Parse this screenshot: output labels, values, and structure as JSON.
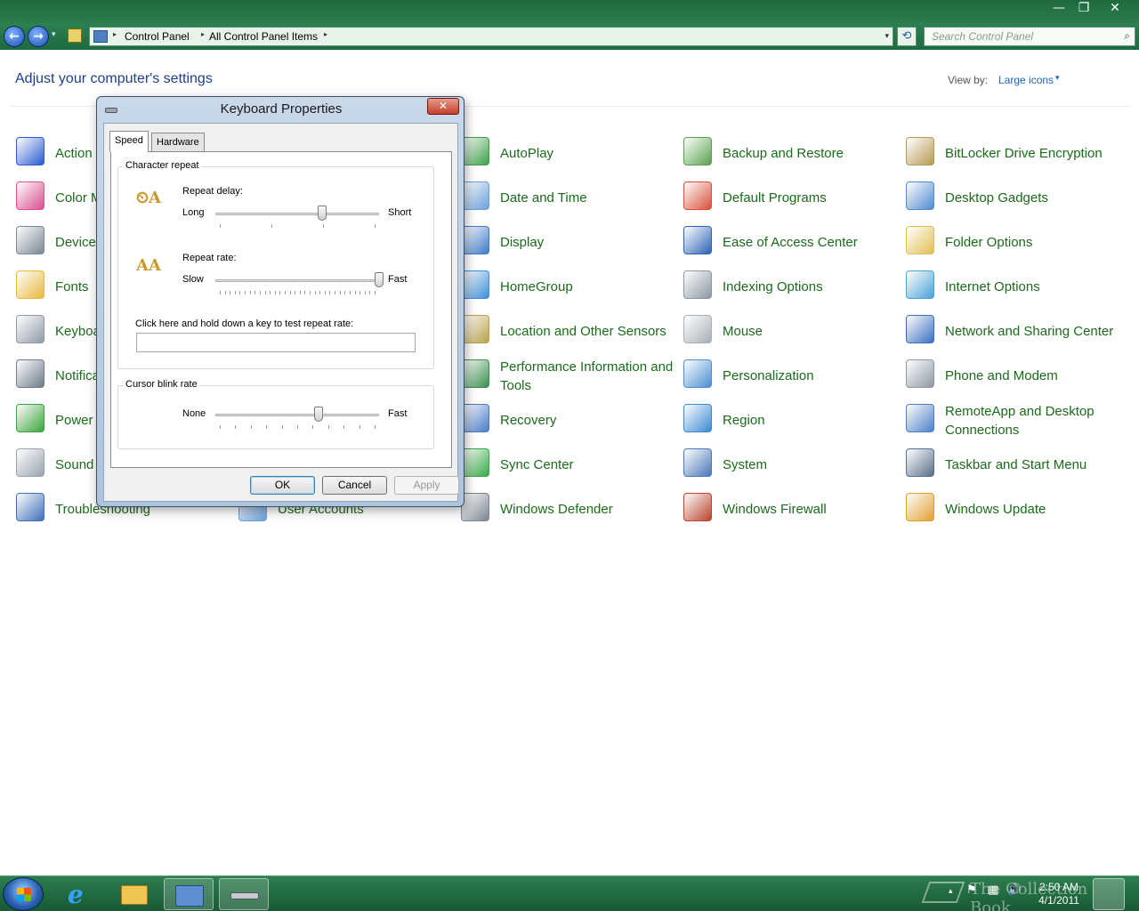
{
  "window": {
    "minimize": "—",
    "maximize": "❐",
    "close": "✕"
  },
  "nav": {
    "back": "←",
    "forward": "→",
    "dropdown": "▾",
    "breadcrumb": [
      "Control Panel",
      "All Control Panel Items"
    ],
    "crumb_sep": "▸",
    "refresh": "⟲",
    "search_placeholder": "Search Control Panel",
    "search_icon": "⌕"
  },
  "header": {
    "title": "Adjust your computer's settings",
    "view_by_label": "View by:",
    "view_by_value": "Large icons",
    "view_by_arrow": "▾"
  },
  "items": [
    {
      "label": "Action Center",
      "color": "#2a5bd0"
    },
    {
      "label": "Color Management",
      "color": "#d94e8f"
    },
    {
      "label": "Device Manager",
      "color": "#7a8794"
    },
    {
      "label": "Fonts",
      "color": "#e7b93f"
    },
    {
      "label": "Keyboard",
      "color": "#8e9aa6"
    },
    {
      "label": "Notification Area Icons",
      "color": "#6b7b8a"
    },
    {
      "label": "Power Options",
      "color": "#3ba33b"
    },
    {
      "label": "Sound",
      "color": "#9aa3ad"
    },
    {
      "label": "Troubleshooting",
      "color": "#3d6fb8"
    },
    {
      "label": "User Accounts",
      "color": "#6aa0d8"
    },
    {
      "label": "AutoPlay",
      "color": "#3e9e4a"
    },
    {
      "label": "Date and Time",
      "color": "#6d9fd8"
    },
    {
      "label": "Display",
      "color": "#3f7ac7"
    },
    {
      "label": "HomeGroup",
      "color": "#3d8fd6"
    },
    {
      "label": "Location and Other Sensors",
      "color": "#b9a04a"
    },
    {
      "label": "Performance Information and Tools",
      "color": "#3a8f4f"
    },
    {
      "label": "Recovery",
      "color": "#4a7bc4"
    },
    {
      "label": "Sync Center",
      "color": "#37a845"
    },
    {
      "label": "Windows Defender",
      "color": "#7b8590"
    },
    {
      "label": "Backup and Restore",
      "color": "#5aa04f"
    },
    {
      "label": "Default Programs",
      "color": "#d8503a"
    },
    {
      "label": "Ease of Access Center",
      "color": "#2d63b5"
    },
    {
      "label": "Indexing Options",
      "color": "#8b96a1"
    },
    {
      "label": "Mouse",
      "color": "#a8afb6"
    },
    {
      "label": "Personalization",
      "color": "#4b8fd0"
    },
    {
      "label": "Region",
      "color": "#3a8ad0"
    },
    {
      "label": "System",
      "color": "#4b78b8"
    },
    {
      "label": "Windows Firewall",
      "color": "#b8452d"
    },
    {
      "label": "BitLocker Drive Encryption",
      "color": "#b59a52"
    },
    {
      "label": "Desktop Gadgets",
      "color": "#4f8ad0"
    },
    {
      "label": "Folder Options",
      "color": "#e2bf55"
    },
    {
      "label": "Internet Options",
      "color": "#4aa2d8"
    },
    {
      "label": "Network and Sharing Center",
      "color": "#3a6fc0"
    },
    {
      "label": "Phone and Modem",
      "color": "#8e98a3"
    },
    {
      "label": "RemoteApp and Desktop Connections",
      "color": "#4c80c8"
    },
    {
      "label": "Taskbar and Start Menu",
      "color": "#5a6f8a"
    },
    {
      "label": "Windows Update",
      "color": "#e0a030"
    }
  ],
  "dialog": {
    "title": "Keyboard Properties",
    "close": "✕",
    "tabs": [
      "Speed",
      "Hardware"
    ],
    "char_repeat": {
      "title": "Character repeat",
      "repeat_delay_label": "Repeat delay:",
      "delay_min": "Long",
      "delay_max": "Short",
      "delay_value": 0.65,
      "repeat_rate_label": "Repeat rate:",
      "rate_min": "Slow",
      "rate_max": "Fast",
      "rate_value": 1.0,
      "test_label": "Click here and hold down a key to test repeat rate:",
      "test_value": ""
    },
    "cursor_blink": {
      "title": "Cursor blink rate",
      "min": "None",
      "max": "Fast",
      "value": 0.63
    },
    "buttons": {
      "ok": "OK",
      "cancel": "Cancel",
      "apply": "Apply"
    }
  },
  "taskbar": {
    "clock_time": "2:50 AM",
    "clock_date": "4/1/2011",
    "watermark": "The Collection Book",
    "tray_flag": "⚑",
    "tray_network": "▦",
    "tray_volume": "🔊",
    "tray_arrow": "▴"
  }
}
